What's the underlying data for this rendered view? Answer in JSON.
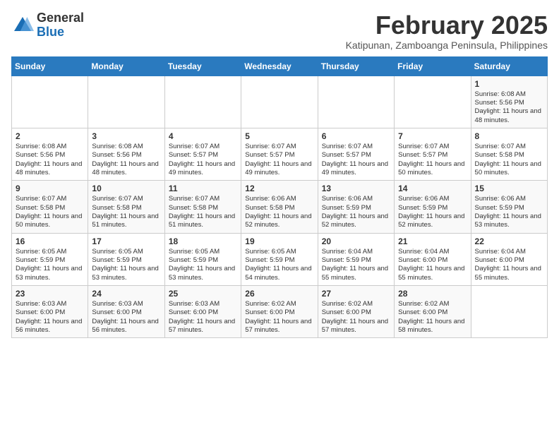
{
  "logo": {
    "general": "General",
    "blue": "Blue"
  },
  "title": "February 2025",
  "subtitle": "Katipunan, Zamboanga Peninsula, Philippines",
  "days_of_week": [
    "Sunday",
    "Monday",
    "Tuesday",
    "Wednesday",
    "Thursday",
    "Friday",
    "Saturday"
  ],
  "weeks": [
    [
      {
        "day": "",
        "info": ""
      },
      {
        "day": "",
        "info": ""
      },
      {
        "day": "",
        "info": ""
      },
      {
        "day": "",
        "info": ""
      },
      {
        "day": "",
        "info": ""
      },
      {
        "day": "",
        "info": ""
      },
      {
        "day": "1",
        "info": "Sunrise: 6:08 AM\nSunset: 5:56 PM\nDaylight: 11 hours and 48 minutes."
      }
    ],
    [
      {
        "day": "2",
        "info": "Sunrise: 6:08 AM\nSunset: 5:56 PM\nDaylight: 11 hours and 48 minutes."
      },
      {
        "day": "3",
        "info": "Sunrise: 6:08 AM\nSunset: 5:56 PM\nDaylight: 11 hours and 48 minutes."
      },
      {
        "day": "4",
        "info": "Sunrise: 6:07 AM\nSunset: 5:57 PM\nDaylight: 11 hours and 49 minutes."
      },
      {
        "day": "5",
        "info": "Sunrise: 6:07 AM\nSunset: 5:57 PM\nDaylight: 11 hours and 49 minutes."
      },
      {
        "day": "6",
        "info": "Sunrise: 6:07 AM\nSunset: 5:57 PM\nDaylight: 11 hours and 49 minutes."
      },
      {
        "day": "7",
        "info": "Sunrise: 6:07 AM\nSunset: 5:57 PM\nDaylight: 11 hours and 50 minutes."
      },
      {
        "day": "8",
        "info": "Sunrise: 6:07 AM\nSunset: 5:58 PM\nDaylight: 11 hours and 50 minutes."
      }
    ],
    [
      {
        "day": "9",
        "info": "Sunrise: 6:07 AM\nSunset: 5:58 PM\nDaylight: 11 hours and 50 minutes."
      },
      {
        "day": "10",
        "info": "Sunrise: 6:07 AM\nSunset: 5:58 PM\nDaylight: 11 hours and 51 minutes."
      },
      {
        "day": "11",
        "info": "Sunrise: 6:07 AM\nSunset: 5:58 PM\nDaylight: 11 hours and 51 minutes."
      },
      {
        "day": "12",
        "info": "Sunrise: 6:06 AM\nSunset: 5:58 PM\nDaylight: 11 hours and 52 minutes."
      },
      {
        "day": "13",
        "info": "Sunrise: 6:06 AM\nSunset: 5:59 PM\nDaylight: 11 hours and 52 minutes."
      },
      {
        "day": "14",
        "info": "Sunrise: 6:06 AM\nSunset: 5:59 PM\nDaylight: 11 hours and 52 minutes."
      },
      {
        "day": "15",
        "info": "Sunrise: 6:06 AM\nSunset: 5:59 PM\nDaylight: 11 hours and 53 minutes."
      }
    ],
    [
      {
        "day": "16",
        "info": "Sunrise: 6:05 AM\nSunset: 5:59 PM\nDaylight: 11 hours and 53 minutes."
      },
      {
        "day": "17",
        "info": "Sunrise: 6:05 AM\nSunset: 5:59 PM\nDaylight: 11 hours and 53 minutes."
      },
      {
        "day": "18",
        "info": "Sunrise: 6:05 AM\nSunset: 5:59 PM\nDaylight: 11 hours and 53 minutes."
      },
      {
        "day": "19",
        "info": "Sunrise: 6:05 AM\nSunset: 5:59 PM\nDaylight: 11 hours and 54 minutes."
      },
      {
        "day": "20",
        "info": "Sunrise: 6:04 AM\nSunset: 5:59 PM\nDaylight: 11 hours and 55 minutes."
      },
      {
        "day": "21",
        "info": "Sunrise: 6:04 AM\nSunset: 6:00 PM\nDaylight: 11 hours and 55 minutes."
      },
      {
        "day": "22",
        "info": "Sunrise: 6:04 AM\nSunset: 6:00 PM\nDaylight: 11 hours and 55 minutes."
      }
    ],
    [
      {
        "day": "23",
        "info": "Sunrise: 6:03 AM\nSunset: 6:00 PM\nDaylight: 11 hours and 56 minutes."
      },
      {
        "day": "24",
        "info": "Sunrise: 6:03 AM\nSunset: 6:00 PM\nDaylight: 11 hours and 56 minutes."
      },
      {
        "day": "25",
        "info": "Sunrise: 6:03 AM\nSunset: 6:00 PM\nDaylight: 11 hours and 57 minutes."
      },
      {
        "day": "26",
        "info": "Sunrise: 6:02 AM\nSunset: 6:00 PM\nDaylight: 11 hours and 57 minutes."
      },
      {
        "day": "27",
        "info": "Sunrise: 6:02 AM\nSunset: 6:00 PM\nDaylight: 11 hours and 57 minutes."
      },
      {
        "day": "28",
        "info": "Sunrise: 6:02 AM\nSunset: 6:00 PM\nDaylight: 11 hours and 58 minutes."
      },
      {
        "day": "",
        "info": ""
      }
    ]
  ]
}
